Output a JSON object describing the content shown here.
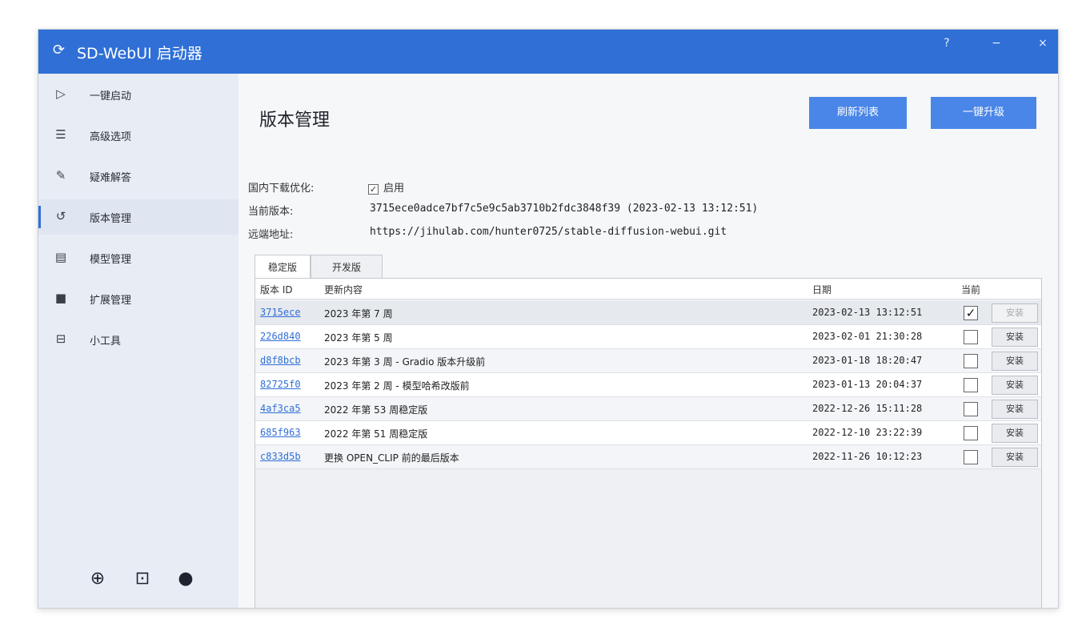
{
  "window": {
    "title": "SD-WebUI 启动器",
    "controls": {
      "help": "?",
      "minimize": "−",
      "close": "×"
    }
  },
  "sidebar": {
    "items": [
      {
        "icon": "play-icon",
        "label": "一键启动"
      },
      {
        "icon": "list-icon",
        "label": "高级选项"
      },
      {
        "icon": "wrench-icon",
        "label": "疑难解答"
      },
      {
        "icon": "history-icon",
        "label": "版本管理",
        "active": true
      },
      {
        "icon": "model-icon",
        "label": "模型管理"
      },
      {
        "icon": "extension-icon",
        "label": "扩展管理"
      },
      {
        "icon": "tools-icon",
        "label": "小工具"
      }
    ],
    "footer_icons": [
      "globe-icon",
      "bilibili-icon",
      "bell-icon"
    ]
  },
  "main": {
    "title": "版本管理",
    "buttons": {
      "refresh": "刷新列表",
      "upgrade": "一键升级"
    },
    "download_opt": {
      "label": "国内下载优化:",
      "checkbox_label": "启用",
      "checked": true
    },
    "current_version": {
      "label": "当前版本:",
      "value": "3715ece0adce7bf7c5e9c5ab3710b2fdc3848f39 (2023-02-13 13:12:51)"
    },
    "remote": {
      "label": "远端地址:",
      "value": "https://jihulab.com/hunter0725/stable-diffusion-webui.git"
    },
    "tabs": [
      "稳定版",
      "开发版"
    ],
    "active_tab": "稳定版",
    "table": {
      "headers": {
        "id": "版本 ID",
        "desc": "更新内容",
        "date": "日期",
        "current": "当前"
      },
      "rows": [
        {
          "id": "3715ece",
          "desc": "2023 年第 7 周",
          "date": "2023-02-13 13:12:51",
          "current": true,
          "install": "安装"
        },
        {
          "id": "226d840",
          "desc": "2023 年第 5 周",
          "date": "2023-02-01 21:30:28",
          "current": false,
          "install": "安装"
        },
        {
          "id": "d8f8bcb",
          "desc": "2023 年第 3 周 - Gradio 版本升级前",
          "date": "2023-01-18 18:20:47",
          "current": false,
          "install": "安装"
        },
        {
          "id": "82725f0",
          "desc": "2023 年第 2 周 - 模型哈希改版前",
          "date": "2023-01-13 20:04:37",
          "current": false,
          "install": "安装"
        },
        {
          "id": "4af3ca5",
          "desc": "2022 年第 53 周稳定版",
          "date": "2022-12-26 15:11:28",
          "current": false,
          "install": "安装"
        },
        {
          "id": "685f963",
          "desc": "2022 年第 51 周稳定版",
          "date": "2022-12-10 23:22:39",
          "current": false,
          "install": "安装"
        },
        {
          "id": "c833d5b",
          "desc": "更换 OPEN_CLIP 前的最后版本",
          "date": "2022-11-26 10:12:23",
          "current": false,
          "install": "安装"
        }
      ]
    }
  },
  "colors": {
    "accent": "#2f6fd6",
    "button": "#4a86e8",
    "link": "#2f6fd6"
  }
}
